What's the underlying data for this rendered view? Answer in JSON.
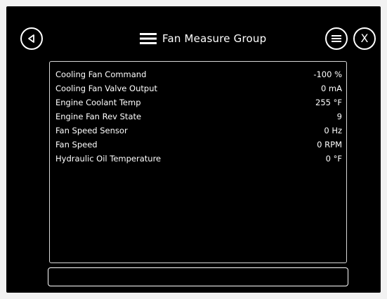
{
  "header": {
    "title": "Fan Measure Group",
    "back_icon": "back-triangle-icon",
    "title_icon": "hamburger-icon",
    "menu_icon": "menu-list-icon",
    "close_label": "X"
  },
  "measurements": [
    {
      "label": "Cooling Fan Command",
      "value": "-100 %"
    },
    {
      "label": "Cooling Fan Valve Output",
      "value": "0 mA"
    },
    {
      "label": "Engine Coolant Temp",
      "value": "255 °F"
    },
    {
      "label": "Engine Fan Rev State",
      "value": "9"
    },
    {
      "label": "Fan Speed Sensor",
      "value": "0 Hz"
    },
    {
      "label": "Fan Speed",
      "value": "0 RPM"
    },
    {
      "label": "Hydraulic Oil Temperature",
      "value": "0 °F"
    }
  ],
  "colors": {
    "background": "#000000",
    "foreground": "#ffffff",
    "outer": "#f2f2f2"
  }
}
